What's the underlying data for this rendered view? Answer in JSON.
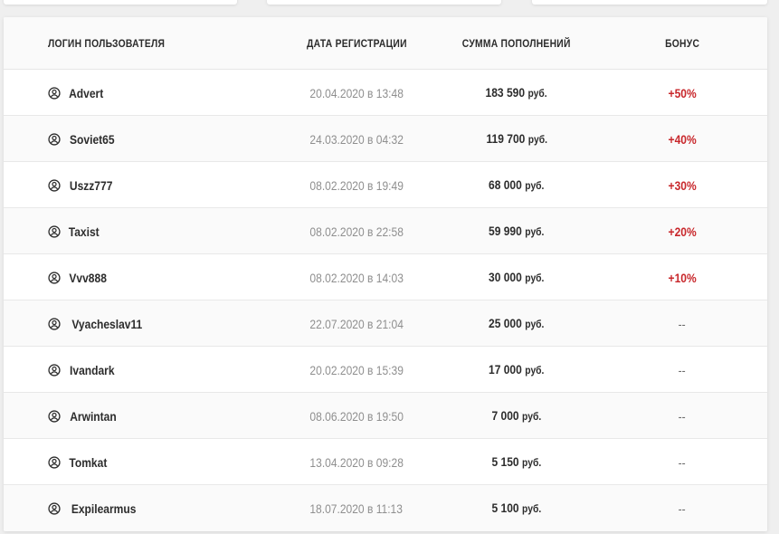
{
  "table": {
    "headers": {
      "login": "ЛОГИН ПОЛЬЗОВАТЕЛЯ",
      "date": "ДАТА РЕГИСТРАЦИИ",
      "amount": "СУММА ПОПОЛНЕНИЙ",
      "bonus": "БОНУС"
    },
    "currency": "руб.",
    "rows": [
      {
        "user": "Advert",
        "date": "20.04.2020 в 13:48",
        "amount": "183 590",
        "bonus": "+50%"
      },
      {
        "user": "Soviet65",
        "date": "24.03.2020 в 04:32",
        "amount": "119 700",
        "bonus": "+40%"
      },
      {
        "user": "Uszz777",
        "date": "08.02.2020 в 19:49",
        "amount": "68 000",
        "bonus": "+30%"
      },
      {
        "user": "Taxist",
        "date": "08.02.2020 в 22:58",
        "amount": "59 990",
        "bonus": "+20%"
      },
      {
        "user": "Vvv888",
        "date": "08.02.2020 в 14:03",
        "amount": "30 000",
        "bonus": "+10%"
      },
      {
        "user": "Vyacheslav11",
        "date": "22.07.2020 в 21:04",
        "amount": "25 000",
        "bonus": "--"
      },
      {
        "user": "Ivandark",
        "date": "20.02.2020 в 15:39",
        "amount": "17 000",
        "bonus": "--"
      },
      {
        "user": "Arwintan",
        "date": "08.06.2020 в 19:50",
        "amount": "7 000",
        "bonus": "--"
      },
      {
        "user": "Tomkat",
        "date": "13.04.2020 в 09:28",
        "amount": "5 150",
        "bonus": "--"
      },
      {
        "user": "Expilearmus",
        "date": "18.07.2020 в 11:13",
        "amount": "5 100",
        "bonus": "--"
      }
    ]
  },
  "colors": {
    "bonus": "#c8272b",
    "text": "#2c2c2c",
    "muted": "#8f8f8f"
  },
  "icons": {
    "user": "user-circle-icon"
  }
}
